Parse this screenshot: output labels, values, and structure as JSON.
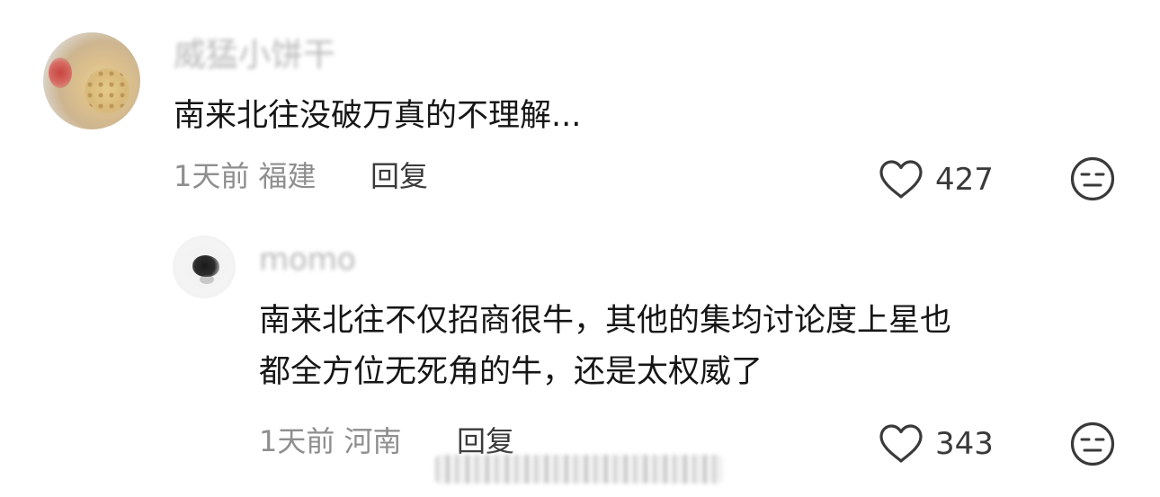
{
  "comments": [
    {
      "username": "威猛小饼干",
      "text_lines": [
        "南来北往没破万真的不理解..."
      ],
      "meta": "1天前 福建",
      "reply_label": "回复",
      "like_count": "427",
      "icons": {
        "like": "heart-outline-icon",
        "dislike": "unhappy-face-icon"
      }
    },
    {
      "username": "momo",
      "text_lines": [
        "南来北往不仅招商很牛，其他的集均讨论度上星也",
        "都全方位无死角的牛，还是太权威了"
      ],
      "meta": "1天前 河南",
      "reply_label": "回复",
      "like_count": "343",
      "icons": {
        "like": "heart-outline-icon",
        "dislike": "unhappy-face-icon"
      }
    }
  ],
  "colors": {
    "text": "#161616",
    "meta": "#8e8e8e",
    "username": "#b8b8b8",
    "icon": "#3a3a3a"
  }
}
